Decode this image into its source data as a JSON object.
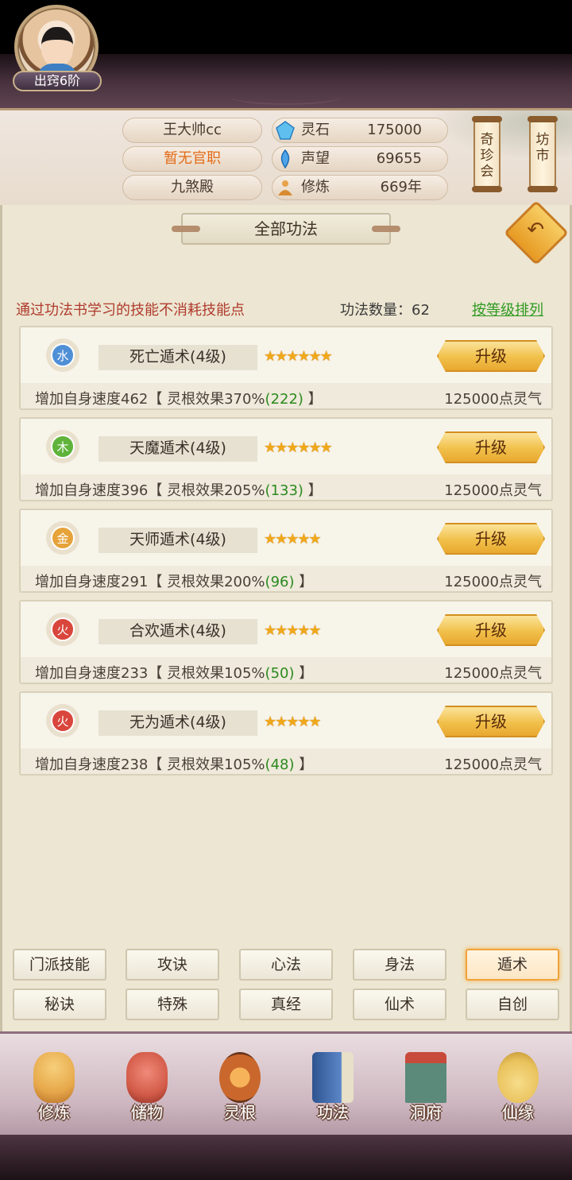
{
  "header": {
    "player_name": "王大帅cc",
    "official_rank": "暂无官职",
    "palace": "九煞殿",
    "realm": "出窍6阶",
    "stats": [
      {
        "icon": "spirit-stone-icon",
        "label": "灵石",
        "value": "175000"
      },
      {
        "icon": "reputation-icon",
        "label": "声望",
        "value": "69655"
      },
      {
        "icon": "cultivation-icon",
        "label": "修炼",
        "value": "669年"
      }
    ],
    "scroll_right_1": "奇珍会",
    "scroll_right_2": "坊市"
  },
  "panel": {
    "title": "全部功法",
    "hint": "通过功法书学习的技能不消耗技能点",
    "count_text": "功法数量：62",
    "sort_link": "按等级排列"
  },
  "skills": [
    {
      "element": "水",
      "element_color": "#4f8fd6",
      "name": "死亡遁术(4级)",
      "stars": "★★★★★★",
      "upgrade": "升级",
      "desc_main": "增加自身速度462【 灵根效果370%",
      "desc_green": "(222)",
      "desc_end": " 】",
      "cost": "125000点灵气"
    },
    {
      "element": "木",
      "element_color": "#5fb33a",
      "name": "天魔遁术(4级)",
      "stars": "★★★★★★",
      "upgrade": "升级",
      "desc_main": "增加自身速度396【 灵根效果205%",
      "desc_green": "(133)",
      "desc_end": " 】",
      "cost": "125000点灵气"
    },
    {
      "element": "金",
      "element_color": "#e6a33a",
      "name": "天师遁术(4级)",
      "stars": "★★★★★",
      "upgrade": "升级",
      "desc_main": "增加自身速度291【 灵根效果200%",
      "desc_green": "(96)",
      "desc_end": " 】",
      "cost": "125000点灵气"
    },
    {
      "element": "火",
      "element_color": "#d9463c",
      "name": "合欢遁术(4级)",
      "stars": "★★★★★",
      "upgrade": "升级",
      "desc_main": "增加自身速度233【 灵根效果105%",
      "desc_green": "(50)",
      "desc_end": " 】",
      "cost": "125000点灵气"
    },
    {
      "element": "火",
      "element_color": "#d9463c",
      "name": "无为遁术(4级)",
      "stars": "★★★★★",
      "upgrade": "升级",
      "desc_main": "增加自身速度238【 灵根效果105%",
      "desc_green": "(48)",
      "desc_end": " 】",
      "cost": "125000点灵气"
    }
  ],
  "categories": [
    "门派技能",
    "攻诀",
    "心法",
    "身法",
    "遁术",
    "秘诀",
    "特殊",
    "真经",
    "仙术",
    "自创"
  ],
  "active_category": "遁术",
  "nav": [
    {
      "label": "修炼",
      "icon": "meditation-icon",
      "color": "#e7a84a"
    },
    {
      "label": "储物",
      "icon": "bag-icon",
      "color": "#d35b48"
    },
    {
      "label": "灵根",
      "icon": "spirit-root-icon",
      "color": "#c9672c"
    },
    {
      "label": "功法",
      "icon": "book-icon",
      "color": "#3f6fb5"
    },
    {
      "label": "洞府",
      "icon": "cave-house-icon",
      "color": "#5b8a7a"
    },
    {
      "label": "仙缘",
      "icon": "gourd-icon",
      "color": "#e9c25c"
    }
  ]
}
